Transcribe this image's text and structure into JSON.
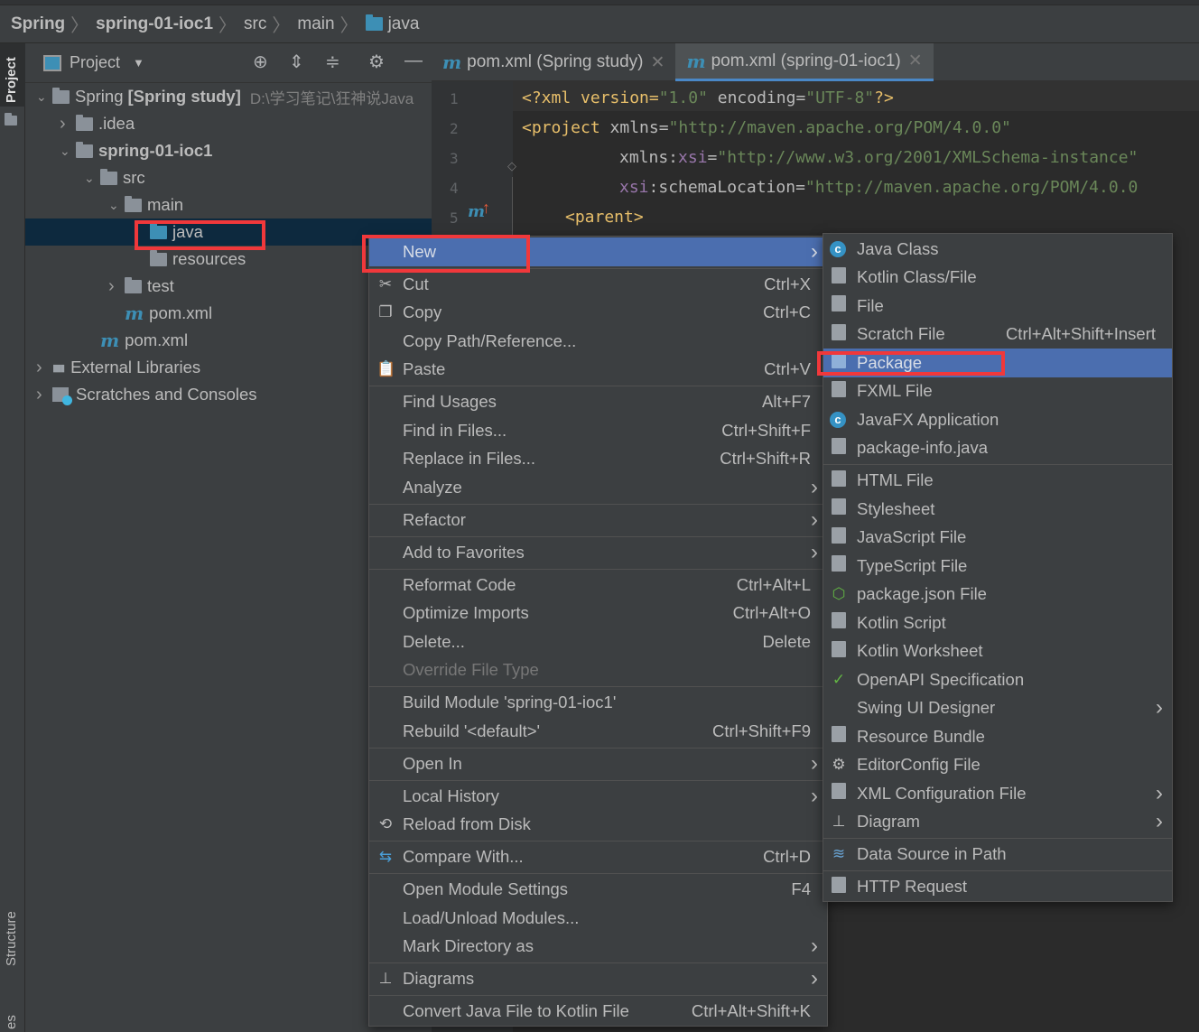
{
  "breadcrumb": [
    "Spring",
    "spring-01-ioc1",
    "src",
    "main",
    "java"
  ],
  "left_strip": {
    "project": "Project",
    "structure": "Structure",
    "bottom": "es"
  },
  "project_panel": {
    "title": "Project"
  },
  "tree": [
    {
      "label": "Spring",
      "bold": "[Spring study]",
      "hint": "D:\\学习笔记\\狂神说Java",
      "depth": 0,
      "arrow": "down",
      "icon": "module-folder"
    },
    {
      "label": ".idea",
      "depth": 1,
      "arrow": "right",
      "icon": "folder"
    },
    {
      "label": "spring-01-ioc1",
      "depth": 1,
      "arrow": "down",
      "icon": "module-folder",
      "isbold": true
    },
    {
      "label": "src",
      "depth": 2,
      "arrow": "down",
      "icon": "folder"
    },
    {
      "label": "main",
      "depth": 3,
      "arrow": "down",
      "icon": "folder"
    },
    {
      "label": "java",
      "depth": 4,
      "arrow": "",
      "icon": "source-folder",
      "selected": true
    },
    {
      "label": "resources",
      "depth": 4,
      "arrow": "",
      "icon": "resources-folder"
    },
    {
      "label": "test",
      "depth": 3,
      "arrow": "right",
      "icon": "folder"
    },
    {
      "label": "pom.xml",
      "depth": 3,
      "arrow": "",
      "icon": "maven"
    },
    {
      "label": "pom.xml",
      "depth": 2,
      "arrow": "",
      "icon": "maven"
    },
    {
      "label": "External Libraries",
      "depth": 0,
      "arrow": "right",
      "icon": "libraries"
    },
    {
      "label": "Scratches and Consoles",
      "depth": 0,
      "arrow": "right",
      "icon": "scratches"
    }
  ],
  "tabs": [
    {
      "label": "pom.xml (Spring study)",
      "active": false
    },
    {
      "label": "pom.xml (spring-01-ioc1)",
      "active": true
    }
  ],
  "code_lines": [
    "1",
    "2",
    "3",
    "4",
    "5"
  ],
  "code": {
    "l1": [
      "<?xml version=",
      "\"1.0\"",
      " encoding=",
      "\"UTF-8\"",
      "?>"
    ],
    "l2": [
      "<project ",
      "xmlns=",
      "\"http://maven.apache.org/POM/4.0.0\""
    ],
    "l3": [
      "xmlns:",
      "xsi",
      "=",
      "\"http://www.w3.org/2001/XMLSchema-instance\""
    ],
    "l4": [
      "xsi",
      ":schemaLocation=",
      "\"http://maven.apache.org/POM/4.0.0"
    ],
    "l5": "<parent>"
  },
  "context_menu": [
    {
      "label": "New",
      "sub": true,
      "hl": true
    },
    {
      "sep": true
    },
    {
      "label": "Cut",
      "sc": "Ctrl+X",
      "icon": "scissors"
    },
    {
      "label": "Copy",
      "sc": "Ctrl+C",
      "icon": "copy"
    },
    {
      "label": "Copy Path/Reference..."
    },
    {
      "label": "Paste",
      "sc": "Ctrl+V",
      "icon": "paste"
    },
    {
      "sep": true
    },
    {
      "label": "Find Usages",
      "sc": "Alt+F7"
    },
    {
      "label": "Find in Files...",
      "sc": "Ctrl+Shift+F"
    },
    {
      "label": "Replace in Files...",
      "sc": "Ctrl+Shift+R"
    },
    {
      "label": "Analyze",
      "sub": true
    },
    {
      "sep": true
    },
    {
      "label": "Refactor",
      "sub": true
    },
    {
      "sep": true
    },
    {
      "label": "Add to Favorites",
      "sub": true
    },
    {
      "sep": true
    },
    {
      "label": "Reformat Code",
      "sc": "Ctrl+Alt+L"
    },
    {
      "label": "Optimize Imports",
      "sc": "Ctrl+Alt+O"
    },
    {
      "label": "Delete...",
      "sc": "Delete"
    },
    {
      "label": "Override File Type",
      "disabled": true
    },
    {
      "sep": true
    },
    {
      "label": "Build Module 'spring-01-ioc1'"
    },
    {
      "label": "Rebuild '<default>'",
      "sc": "Ctrl+Shift+F9"
    },
    {
      "sep": true
    },
    {
      "label": "Open In",
      "sub": true
    },
    {
      "sep": true
    },
    {
      "label": "Local History",
      "sub": true
    },
    {
      "label": "Reload from Disk",
      "icon": "reload"
    },
    {
      "sep": true
    },
    {
      "label": "Compare With...",
      "sc": "Ctrl+D",
      "icon": "compare"
    },
    {
      "sep": true
    },
    {
      "label": "Open Module Settings",
      "sc": "F4"
    },
    {
      "label": "Load/Unload Modules..."
    },
    {
      "label": "Mark Directory as",
      "sub": true
    },
    {
      "sep": true
    },
    {
      "label": "Diagrams",
      "sub": true,
      "icon": "diagram"
    },
    {
      "sep": true
    },
    {
      "label": "Convert Java File to Kotlin File",
      "sc": "Ctrl+Alt+Shift+K"
    }
  ],
  "new_submenu": [
    {
      "label": "Java Class",
      "icon": "java-class"
    },
    {
      "label": "Kotlin Class/File",
      "icon": "kotlin-file"
    },
    {
      "label": "File",
      "icon": "file"
    },
    {
      "label": "Scratch File",
      "sc": "Ctrl+Alt+Shift+Insert",
      "icon": "scratch-file"
    },
    {
      "label": "Package",
      "icon": "package",
      "hl": true
    },
    {
      "label": "FXML File",
      "icon": "fxml-file"
    },
    {
      "label": "JavaFX Application",
      "icon": "javafx"
    },
    {
      "label": "package-info.java",
      "icon": "package-info"
    },
    {
      "sep": true
    },
    {
      "label": "HTML File",
      "icon": "html-file"
    },
    {
      "label": "Stylesheet",
      "icon": "css-file"
    },
    {
      "label": "JavaScript File",
      "icon": "js-file"
    },
    {
      "label": "TypeScript File",
      "icon": "ts-file"
    },
    {
      "label": "package.json File",
      "icon": "nodejs"
    },
    {
      "label": "Kotlin Script",
      "icon": "kotlin-script"
    },
    {
      "label": "Kotlin Worksheet",
      "icon": "kotlin-worksheet"
    },
    {
      "label": "OpenAPI Specification",
      "icon": "openapi"
    },
    {
      "label": "Swing UI Designer",
      "sub": true
    },
    {
      "label": "Resource Bundle",
      "icon": "resource-bundle"
    },
    {
      "label": "EditorConfig File",
      "icon": "gear"
    },
    {
      "label": "XML Configuration File",
      "sub": true,
      "icon": "xml-file"
    },
    {
      "label": "Diagram",
      "sub": true,
      "icon": "diagram"
    },
    {
      "sep": true
    },
    {
      "label": "Data Source in Path",
      "icon": "database"
    },
    {
      "sep": true
    },
    {
      "label": "HTTP Request",
      "icon": "api"
    }
  ],
  "colors": {
    "highlight": "#4b6eaf",
    "selection": "#0d293e",
    "annotation_box": "#f0383b",
    "maven": "#3d8fb5"
  }
}
